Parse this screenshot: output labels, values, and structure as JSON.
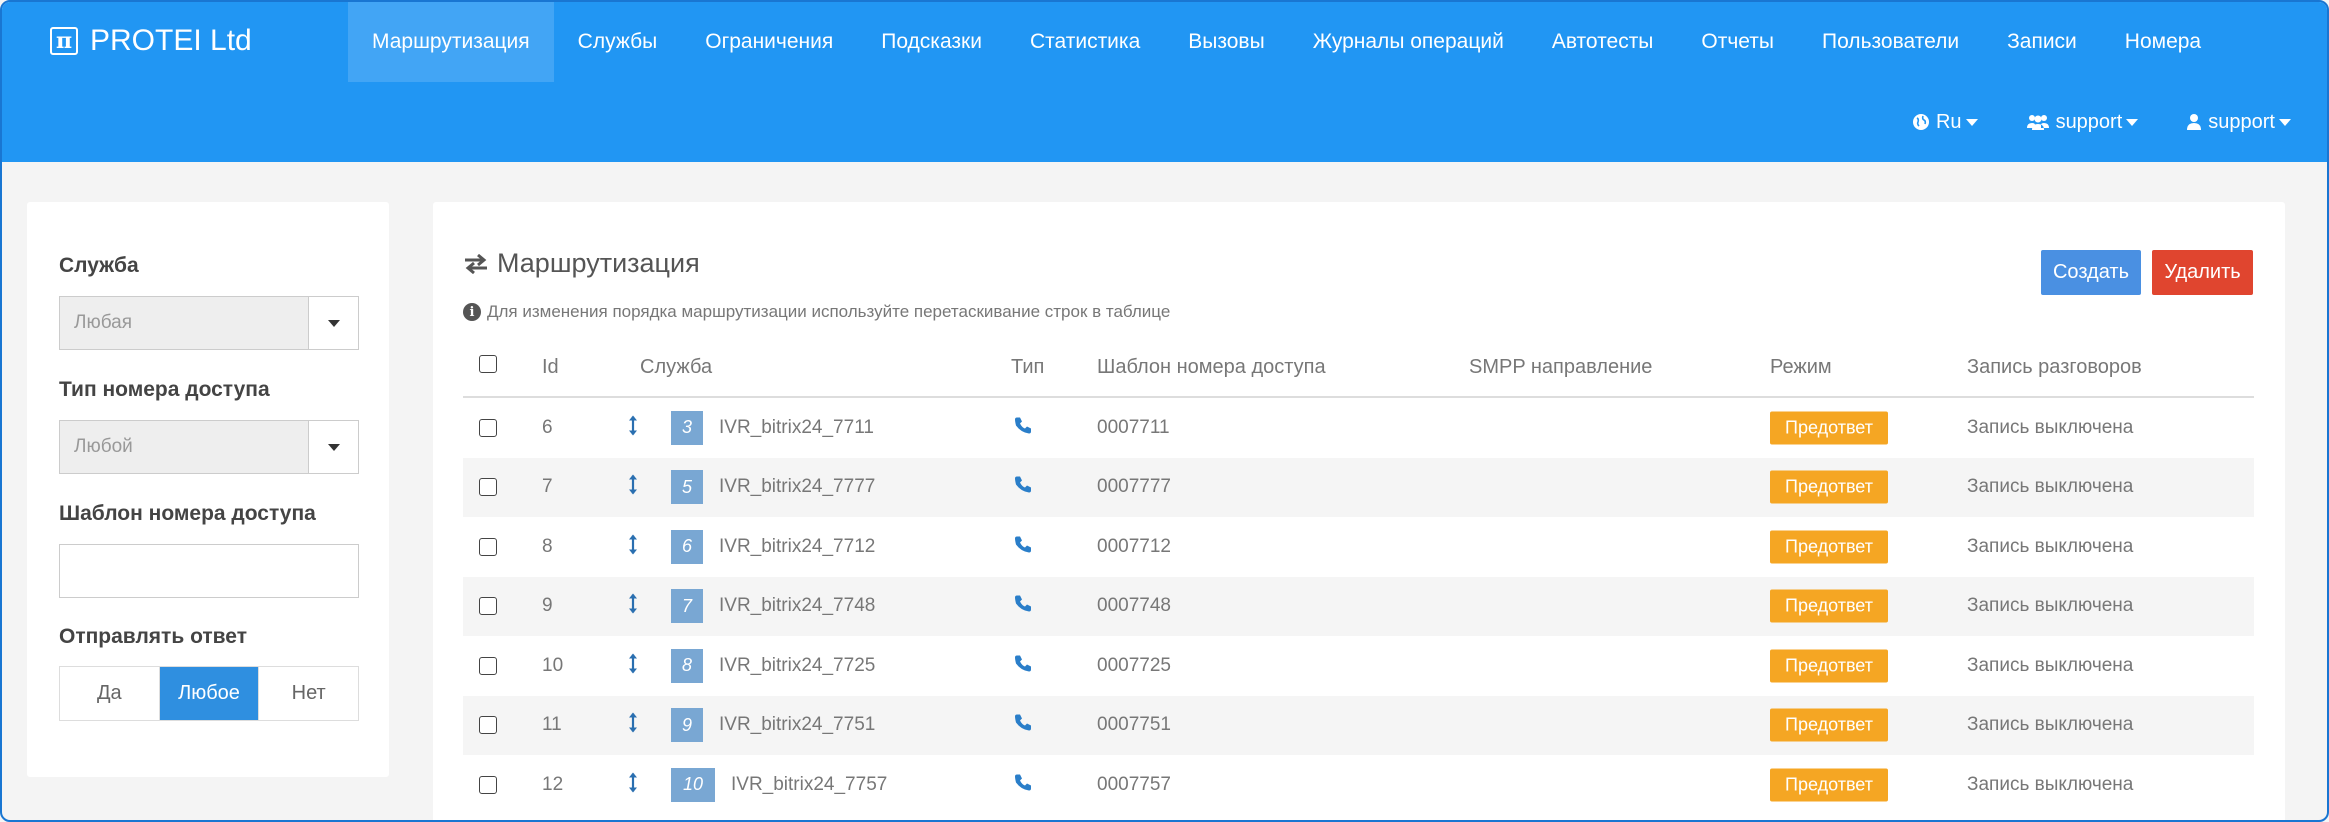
{
  "brand": {
    "name": "PROTEI Ltd",
    "logo_glyph": "π"
  },
  "nav": {
    "items": [
      {
        "label": "Маршрутизация",
        "active": true
      },
      {
        "label": "Службы"
      },
      {
        "label": "Ограничения"
      },
      {
        "label": "Подсказки"
      },
      {
        "label": "Статистика"
      },
      {
        "label": "Вызовы"
      },
      {
        "label": "Журналы операций"
      },
      {
        "label": "Автотесты"
      },
      {
        "label": "Отчеты"
      },
      {
        "label": "Пользователи"
      },
      {
        "label": "Записи"
      },
      {
        "label": "Номера"
      }
    ]
  },
  "user_nav": {
    "language": "Ru",
    "group": "support",
    "user": "support"
  },
  "filters": {
    "service_label": "Служба",
    "service_value": "Любая",
    "type_label": "Тип номера доступа",
    "type_value": "Любой",
    "template_label": "Шаблон номера доступа",
    "template_value": "",
    "send_label": "Отправлять ответ",
    "send_options": [
      "Да",
      "Любое",
      "Нет"
    ],
    "send_selected": "Любое"
  },
  "main": {
    "title": "Маршрутизация",
    "hint": "Для изменения порядка маршрутизации используйте перетаскивание строк в таблице",
    "create_label": "Создать",
    "delete_label": "Удалить",
    "columns": {
      "id": "Id",
      "service": "Служба",
      "type": "Тип",
      "template": "Шаблон номера доступа",
      "smpp": "SMPP направление",
      "mode": "Режим",
      "record": "Запись разговоров"
    },
    "rows": [
      {
        "id": "6",
        "num": "3",
        "service": "IVR_bitrix24_7711",
        "template": "0007711",
        "smpp": "",
        "mode": "Предответ",
        "record": "Запись выключена"
      },
      {
        "id": "7",
        "num": "5",
        "service": "IVR_bitrix24_7777",
        "template": "0007777",
        "smpp": "",
        "mode": "Предответ",
        "record": "Запись выключена"
      },
      {
        "id": "8",
        "num": "6",
        "service": "IVR_bitrix24_7712",
        "template": "0007712",
        "smpp": "",
        "mode": "Предответ",
        "record": "Запись выключена"
      },
      {
        "id": "9",
        "num": "7",
        "service": "IVR_bitrix24_7748",
        "template": "0007748",
        "smpp": "",
        "mode": "Предответ",
        "record": "Запись выключена"
      },
      {
        "id": "10",
        "num": "8",
        "service": "IVR_bitrix24_7725",
        "template": "0007725",
        "smpp": "",
        "mode": "Предответ",
        "record": "Запись выключена"
      },
      {
        "id": "11",
        "num": "9",
        "service": "IVR_bitrix24_7751",
        "template": "0007751",
        "smpp": "",
        "mode": "Предответ",
        "record": "Запись выключена"
      },
      {
        "id": "12",
        "num": "10",
        "service": "IVR_bitrix24_7757",
        "template": "0007757",
        "smpp": "",
        "mode": "Предответ",
        "record": "Запись выключена"
      }
    ]
  },
  "colors": {
    "topbar": "#2196f3",
    "nav_active": "#42a5f5",
    "create_button": "#4a90e2",
    "delete_button": "#e0452f",
    "mode_badge": "#f5a623",
    "number_badge": "#79a7d3",
    "segment_selected": "#2f8fe0",
    "phone_icon": "#2a7ec9"
  }
}
